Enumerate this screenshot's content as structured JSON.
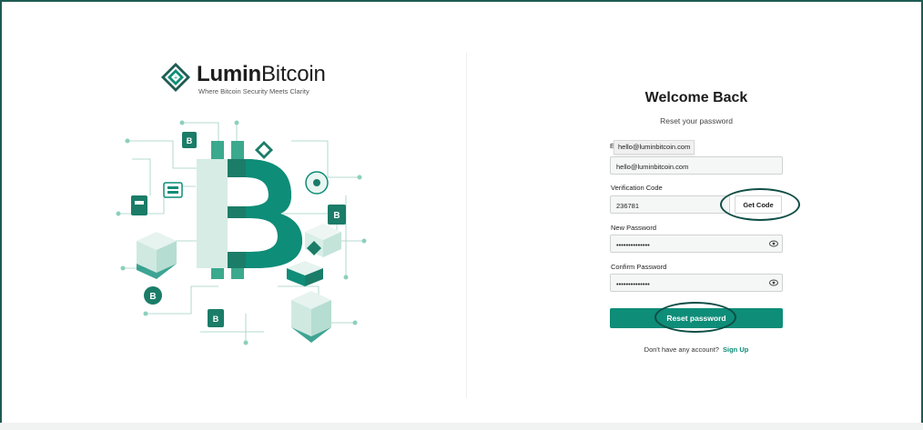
{
  "brand": {
    "name_bold": "Lumin",
    "name_regular": "Bitcoin",
    "tagline": "Where Bitcoin Security Meets Clarity"
  },
  "colors": {
    "accent": "#0e8d78",
    "frame": "#1e5b53",
    "annotation": "#0f4e46"
  },
  "form": {
    "title": "Welcome Back",
    "subtitle": "Reset your password",
    "email": {
      "label_fragment": "E",
      "autofill_suggestion": "hello@luminbitcoin.com",
      "value": "hello@luminbitcoin.com"
    },
    "verification": {
      "label": "Verification Code",
      "value": "236781",
      "get_code_label": "Get Code"
    },
    "new_password": {
      "label": "New Password",
      "value": "••••••••••••••"
    },
    "confirm_password": {
      "label": "Confirm Password",
      "value": "••••••••••••••"
    },
    "reset_label": "Reset password",
    "signup_prompt": "Don't have any account?",
    "signup_link": "Sign Up"
  },
  "icons": {
    "logo": "diamond-logo-icon",
    "eye": "eye-icon"
  }
}
